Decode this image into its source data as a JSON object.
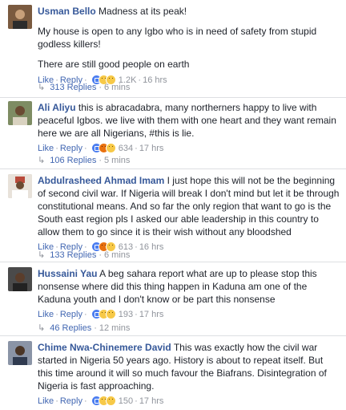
{
  "colors": {
    "link": "#365899",
    "action": "#4267b2",
    "meta": "#90949c",
    "text": "#1d2129"
  },
  "comments": [
    {
      "name": "Usman Bello",
      "text": "Madness at its peak!",
      "paragraphs": [
        "My house is open to any Igbo who is in need of safety from stupid godless killers!",
        "There are still good people on earth"
      ],
      "like_label": "Like",
      "reply_label": "Reply",
      "reactions": [
        "like-icon",
        "wow-icon",
        "sad-icon"
      ],
      "reaction_count": "1.2K",
      "time": "16 hrs",
      "replies_label": "313 Replies",
      "replies_time": "6 mins",
      "avatar_color": "#8c6a4f"
    },
    {
      "name": "Ali Aliyu",
      "text": "this is abracadabra, many northerners happy to live with peaceful Igbos. we live with them with one heart and they want remain here we are all Nigerians, #this is lie.",
      "paragraphs": [],
      "like_label": "Like",
      "reply_label": "Reply",
      "reactions": [
        "like-icon",
        "angry-icon",
        "haha-icon"
      ],
      "reaction_count": "634",
      "time": "17 hrs",
      "replies_label": "106 Replies",
      "replies_time": "5 mins",
      "avatar_color": "#6b7a55"
    },
    {
      "name": "Abdulrasheed Ahmad Imam",
      "text": "I just hope this will not be the beginning of second civil war. If Nigeria will break I don't mind but let it be through constitutional means. And so far the only region that want to go is the South east region pls I asked our able leadership in this country to allow them to go since it is their wish without any bloodshed",
      "paragraphs": [],
      "like_label": "Like",
      "reply_label": "Reply",
      "reactions": [
        "like-icon",
        "angry-icon",
        "wow-icon"
      ],
      "reaction_count": "613",
      "time": "16 hrs",
      "replies_label": "133 Replies",
      "replies_time": "6 mins",
      "avatar_color": "#b94a3a"
    },
    {
      "name": "Hussaini Yau",
      "text": "A beg sahara report what are up to please stop this nonsense where did this thing happen in Kaduna am one of the Kaduna youth and I don't know or be part this nonsense",
      "paragraphs": [],
      "like_label": "Like",
      "reply_label": "Reply",
      "reactions": [
        "like-icon",
        "haha-icon",
        "sad-icon"
      ],
      "reaction_count": "193",
      "time": "17 hrs",
      "replies_label": "46 Replies",
      "replies_time": "12 mins",
      "avatar_color": "#3b3b3b"
    },
    {
      "name": "Chime Nwa-Chinemere David",
      "text": "This was exactly how the civil war started in Nigeria 50 years ago. History is about to repeat itself. But this time around it will so much favour the Biafrans. Disintegration of Nigeria is fast approaching.",
      "paragraphs": [],
      "like_label": "Like",
      "reply_label": "Reply",
      "reactions": [
        "like-icon",
        "haha-icon",
        "wow-icon"
      ],
      "reaction_count": "150",
      "time": "17 hrs",
      "replies_label": "",
      "replies_time": "",
      "avatar_color": "#5f6b80"
    }
  ]
}
